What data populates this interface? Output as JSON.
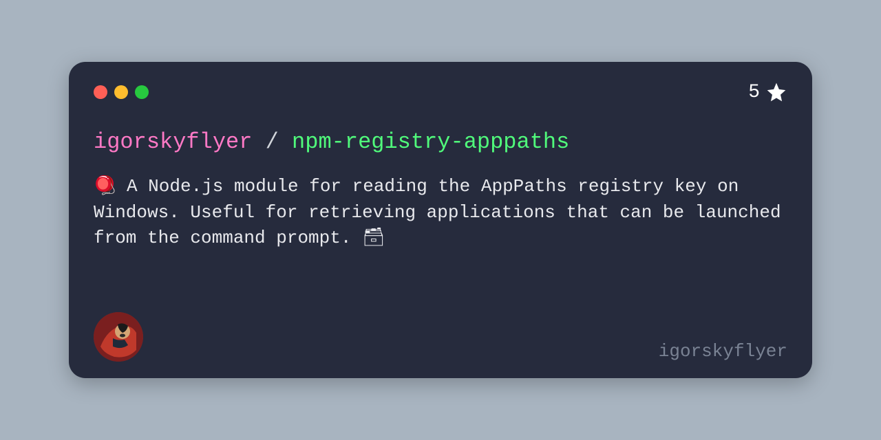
{
  "stars": {
    "count": "5"
  },
  "repo": {
    "owner": "igorskyflyer",
    "separator": " / ",
    "name": "npm-registry-apppaths"
  },
  "description": "🪀 A Node.js module for reading the AppPaths registry key on Windows. Useful for retrieving applications that can be launched from the command prompt. 🗃",
  "footer": {
    "username": "igorskyflyer"
  }
}
